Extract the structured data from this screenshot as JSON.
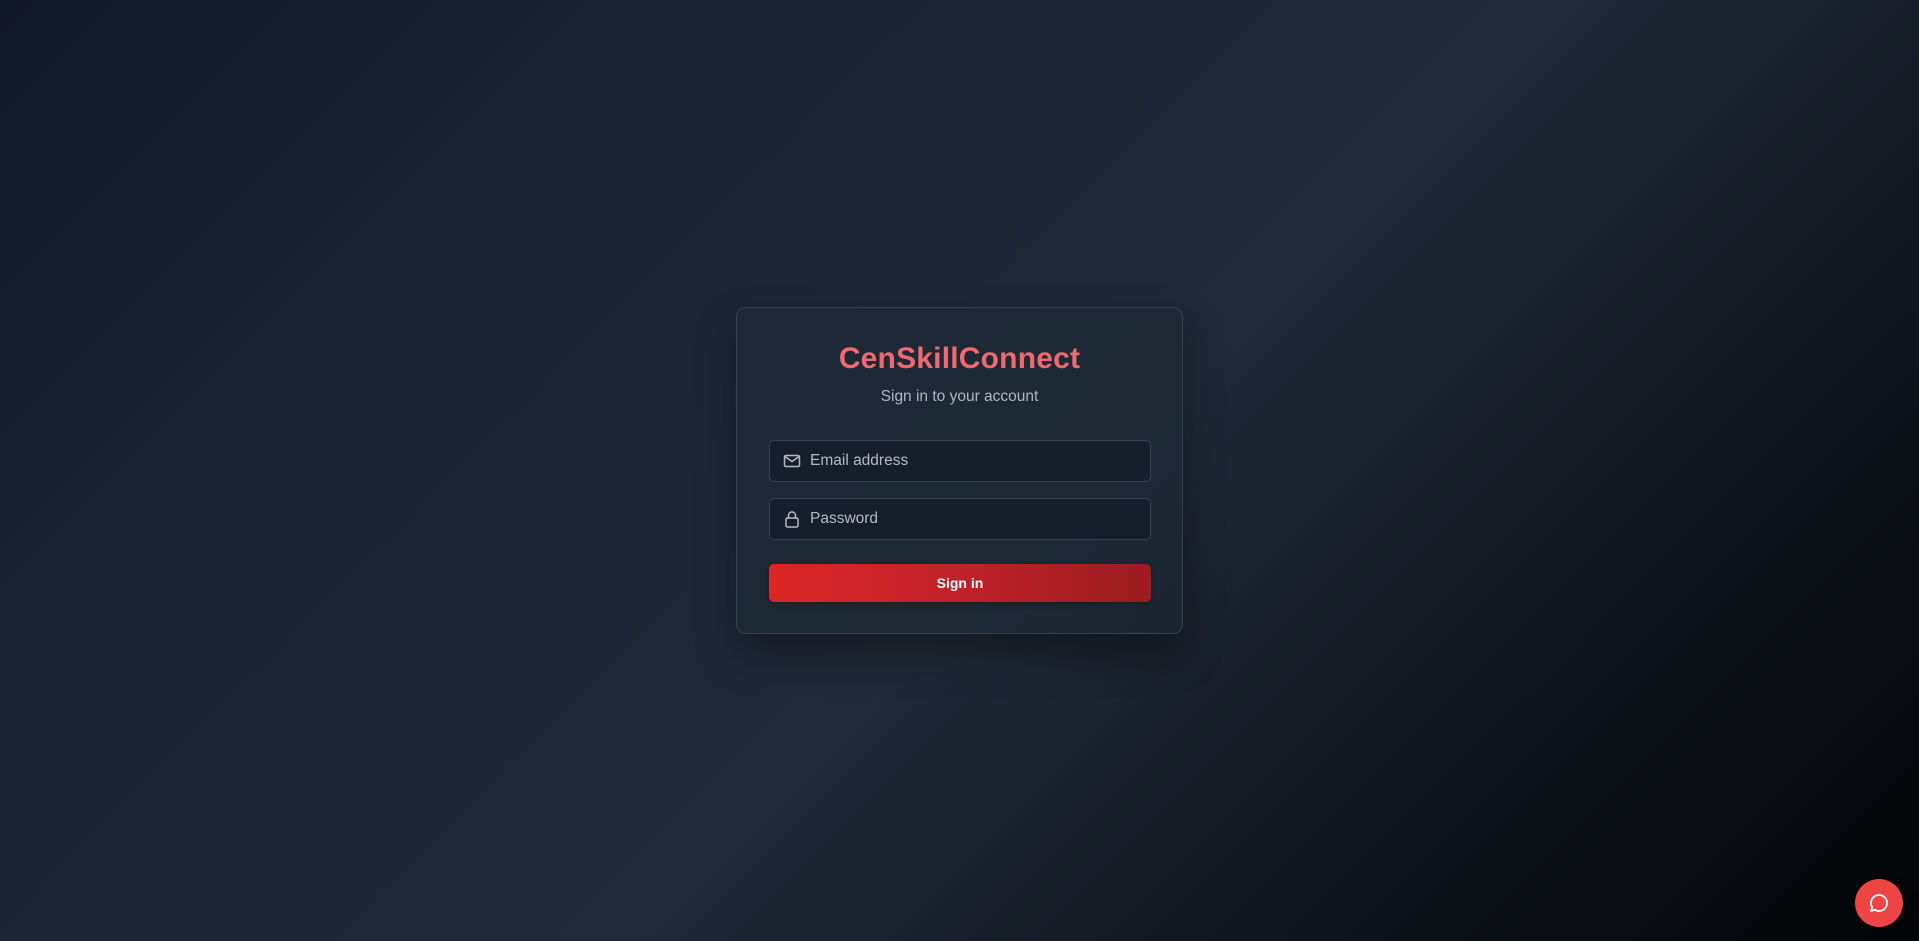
{
  "login": {
    "brand": "CenSkillConnect",
    "subtitle": "Sign in to your account",
    "email_placeholder": "Email address",
    "email_value": "",
    "password_placeholder": "Password",
    "password_value": "",
    "submit_label": "Sign in"
  },
  "icons": {
    "email": "mail-icon",
    "password": "lock-icon",
    "chat": "chat-bubble-icon"
  },
  "colors": {
    "brand": "#ee6a6f",
    "button_start": "#dc2626",
    "button_end": "#9b1c1f",
    "chat_button": "#ef4444"
  }
}
